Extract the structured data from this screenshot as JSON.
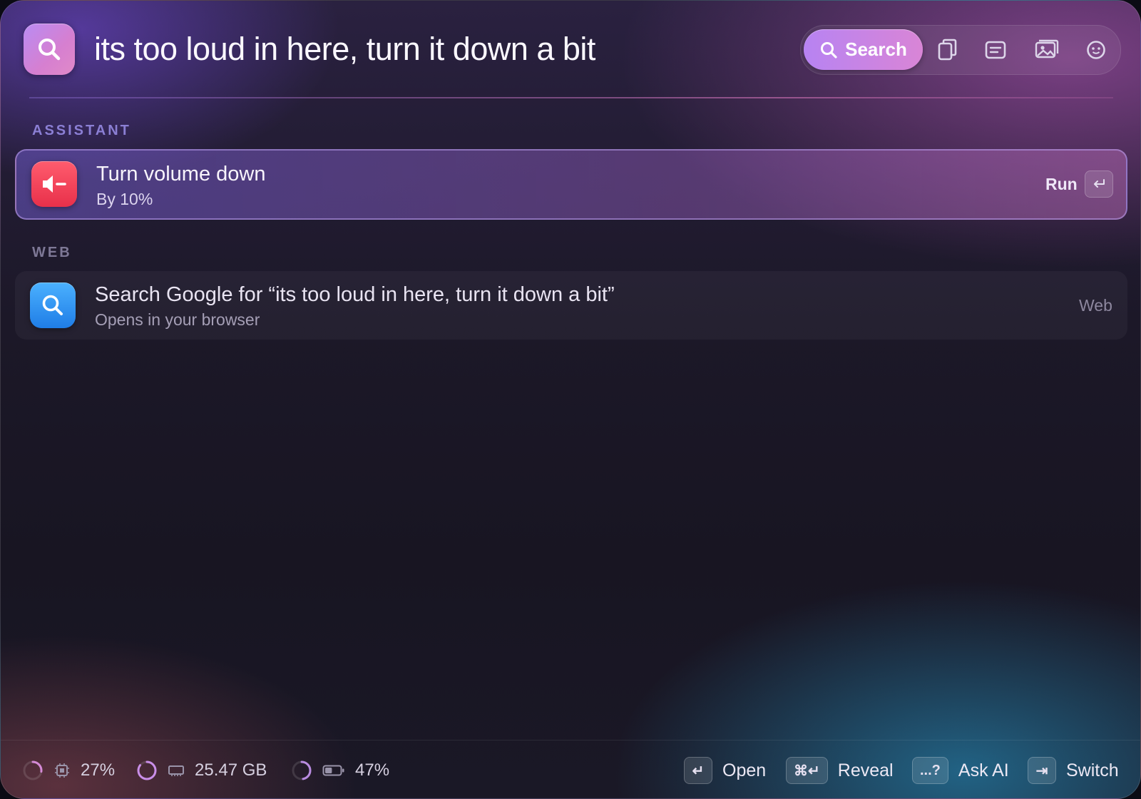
{
  "header": {
    "query": "its too loud in here, turn it down a bit",
    "modes": {
      "search_label": "Search",
      "icons": [
        "search-icon",
        "clipboard-icon",
        "notes-icon",
        "photos-icon",
        "ai-chat-icon"
      ]
    }
  },
  "sections": {
    "assistant_label": "ASSISTANT",
    "web_label": "WEB"
  },
  "results": {
    "assistant": {
      "title": "Turn volume down",
      "subtitle": "By 10%",
      "action": "Run",
      "icon": "speaker-minus-icon"
    },
    "web": {
      "title": "Search Google for “its too loud in here, turn it down a bit”",
      "subtitle": "Opens in your browser",
      "action": "Web",
      "icon": "search-icon"
    }
  },
  "footer": {
    "stats": {
      "cpu": {
        "value": "27%",
        "fraction": 0.27
      },
      "memory": {
        "value": "25.47 GB",
        "fraction": 0.85
      },
      "battery": {
        "value": "47%",
        "fraction": 0.47
      }
    },
    "actions": {
      "open": {
        "key": "↵",
        "label": "Open"
      },
      "reveal": {
        "key": "⌘↵",
        "label": "Reveal"
      },
      "ask_ai": {
        "key": "...?",
        "label": "Ask AI"
      },
      "switch": {
        "key": "⇥",
        "label": "Switch"
      }
    }
  },
  "colors": {
    "accent_purple": "#b783f2",
    "accent_pink": "#d985d6",
    "volume_red": "#ef3b55",
    "search_blue": "#2f8fee",
    "section_label": "#8b7fd4"
  }
}
